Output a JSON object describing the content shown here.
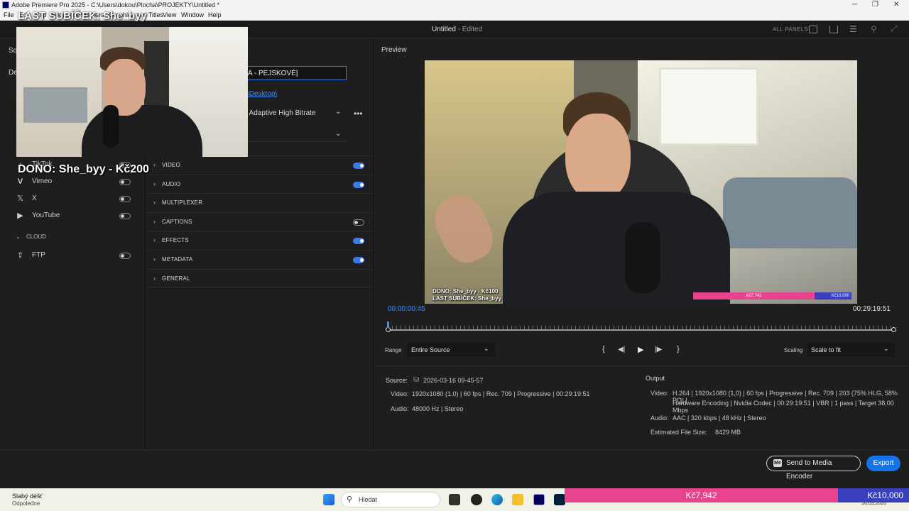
{
  "window": {
    "title": "Adobe Premiere Pro 2025 - C:\\Users\\dokou\\Plocha\\PROJEKTY\\Untitled *",
    "menus": [
      "File",
      "Edit",
      "Clip",
      "Sequence",
      "Markers",
      "Graphics and Titles",
      "View",
      "Window",
      "Help"
    ]
  },
  "header": {
    "doc_name": "Untitled",
    "doc_state": "- Edited",
    "all_panels": "ALL PANELS"
  },
  "left": {
    "tab_label": "So",
    "dest_label": "De",
    "destinations": [
      {
        "label": "TikTok",
        "icon": "tiktok-icon",
        "on": false
      },
      {
        "label": "Vimeo",
        "icon": "vimeo-icon",
        "on": false
      },
      {
        "label": "X",
        "icon": "x-icon",
        "on": false
      },
      {
        "label": "YouTube",
        "icon": "youtube-icon",
        "on": false
      }
    ],
    "cloud_label": "CLOUD",
    "ftp": {
      "label": "FTP",
      "on": false
    }
  },
  "mid": {
    "filename": "A - PEJSKOVÉ",
    "location": "\\Desktop\\",
    "preset": "- Adaptive High Bitrate",
    "sections": [
      {
        "label": "VIDEO",
        "on": true
      },
      {
        "label": "AUDIO",
        "on": true
      },
      {
        "label": "MULTIPLEXER"
      },
      {
        "label": "CAPTIONS",
        "on": false
      },
      {
        "label": "EFFECTS",
        "on": true
      },
      {
        "label": "METADATA",
        "on": true
      },
      {
        "label": "GENERAL"
      }
    ]
  },
  "preview": {
    "label": "Preview",
    "current_time": "00:00:00:45",
    "duration": "00:29:19:51",
    "playhead_fraction": 0.0,
    "overlay_dono": "DONO: She_byy - Kč100",
    "overlay_sub": "LAST SUBÍČEK: She_byy",
    "overlay_bar_left": "Kč7,742",
    "overlay_bar_right": "Kč10,000",
    "range_label": "Range",
    "range_value": "Entire Source",
    "scaling_label": "Scaling",
    "scaling_value": "Scale to fit"
  },
  "source": {
    "label": "Source:",
    "name": "2026-03-16 09-45-57",
    "video_key": "Video:",
    "video": "1920x1080 (1,0)  |  60 fps  |  Rec. 709  |  Progressive  |  00:29:19:51",
    "audio_key": "Audio:",
    "audio": "48000 Hz  |  Stereo"
  },
  "output": {
    "label": "Output",
    "video_key": "Video:",
    "video_line1": "H.264  |  1920x1080 (1,0)  |  60 fps  |  Progressive  |  Rec. 709  |  203 (75% HLG, 58% PQ)  |",
    "video_line2": "Hardware Encoding  |  Nvidia Codec  |  00:29:19:51  |  VBR  |  1 pass  |  Target 38,00 Mbps",
    "audio_key": "Audio:",
    "audio": "AAC  |  320 kbps  |  48 kHz  |  Stereo",
    "size_key": "Estimated File Size:",
    "size": "8429 MB"
  },
  "footer": {
    "send_label": "Send to Media Encoder",
    "export_label": "Export"
  },
  "taskbar": {
    "weather_title": "Slabý déšť",
    "weather_sub": "Odpoledne",
    "search_placeholder": "Hledat",
    "date": "16.03.2026"
  },
  "stream_overlay": {
    "webcam_caption": "LAST SUBÍČEK: She_byy",
    "dono_text": "DONO: She_byy - Kč200",
    "goal_current": "Kč7,942",
    "goal_target": "Kč10,000",
    "goal_fraction": 0.7942
  },
  "colors": {
    "accent": "#1473e6",
    "toggle_on": "#3b7be8",
    "goal_pink": "#e9438e",
    "goal_blue": "#3a3fbf"
  }
}
